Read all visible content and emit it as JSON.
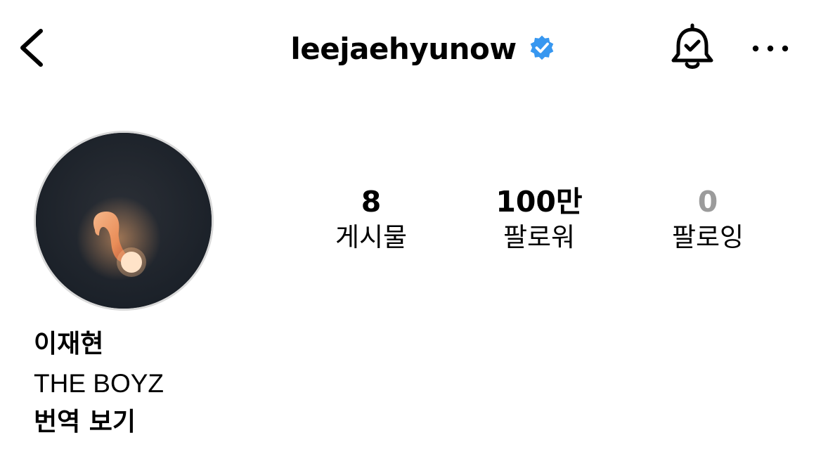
{
  "header": {
    "username": "leejaehyunow",
    "verified_color": "#3797f0",
    "icons": {
      "back": "chevron-left-icon",
      "verified": "verified-badge-icon",
      "notifications": "bell-check-icon",
      "more": "more-horizontal-icon"
    }
  },
  "stats": [
    {
      "value": "8",
      "label": "게시물"
    },
    {
      "value": "100만",
      "label": "팔로워"
    },
    {
      "value": "0",
      "label": "팔로잉"
    }
  ],
  "profile": {
    "display_name": "이재현",
    "bio": "THE BOYZ",
    "translate_label": "번역 보기"
  },
  "colors": {
    "text": "#000000",
    "muted": "#9b9b9b",
    "avatar_border": "#d9d9d9"
  }
}
